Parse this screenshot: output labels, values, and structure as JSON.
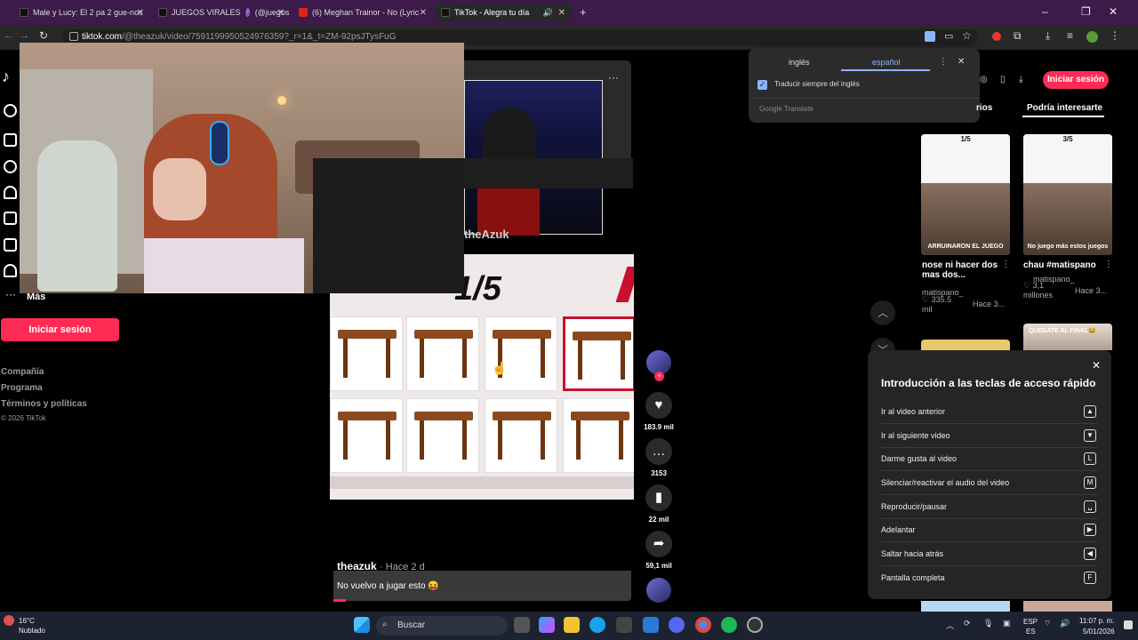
{
  "browser": {
    "tabs": [
      {
        "title": "Male y Lucy: El 2 pa 2 gue-nos"
      },
      {
        "title": "JUEGOS VIRALES 🪻 (@juegos"
      },
      {
        "title": "(6) Meghan Trainor - No (Lyric"
      },
      {
        "title": "TikTok - Alegra tu día"
      }
    ],
    "url_host": "tiktok.com",
    "url_path": "/@theazuk/video/7591199950524976359?_r=1&_t=ZM-92psJTysFuG"
  },
  "translate": {
    "tab_from": "inglés",
    "tab_to": "español",
    "checkbox_label": "Traducir siempre del inglés",
    "footer": "Google Translate"
  },
  "sidebar": {
    "more_label": "Más",
    "login_button": "Iniciar sesión",
    "links": [
      "Compañía",
      "Programa",
      "Términos y políticas"
    ],
    "copyright": "© 2026 TikTok"
  },
  "video": {
    "brand_overlay": "theAzuk",
    "puzzle_label": "1/5",
    "creator": "theazuk",
    "time_ago": "· Hace 2 d",
    "description": "No vuelvo a jugar esto 😝"
  },
  "actions": {
    "likes": "183.9 mil",
    "comments": "3153",
    "saves": "22 mil",
    "shares": "59,1 mil"
  },
  "right": {
    "login_button": "Iniciar sesión",
    "tab_partial": "rios",
    "tab_active": "Podría interesarte",
    "items": [
      {
        "frac": "1/5",
        "thumb_caption": "ARRUINARON EL JUEGO",
        "title": "nose ni hacer dos mas dos...",
        "user": "matispano_",
        "likes": "335.5 mil",
        "time": "Hace 3..."
      },
      {
        "frac": "3/5",
        "thumb_caption": "No juego más estos juegos",
        "title": "chau #matispano",
        "user": "matispano_",
        "likes": "3,1 millones",
        "time": "Hace 3..."
      }
    ],
    "peek_caption": "QUEDATE AL FINAL😂"
  },
  "shortcuts": {
    "title": "Introducción a las teclas de acceso rápido",
    "rows": [
      {
        "label": "Ir al video anterior",
        "key": "▲"
      },
      {
        "label": "Ir al siguiente video",
        "key": "▼"
      },
      {
        "label": "Darme gusta al video",
        "key": "L"
      },
      {
        "label": "Silenciar/reactivar el audio del video",
        "key": "M"
      },
      {
        "label": "Reproducir/pausar",
        "key": "␣"
      },
      {
        "label": "Adelantar",
        "key": "▶"
      },
      {
        "label": "Saltar hacia atrás",
        "key": "◀"
      },
      {
        "label": "Pantalla completa",
        "key": "F"
      }
    ]
  },
  "taskbar": {
    "temp": "16°C",
    "weather": "Nublado",
    "search_placeholder": "Buscar",
    "lang": "ESP",
    "lang_sub": "ES",
    "time": "11:07 p. m.",
    "date": "5/01/2026"
  },
  "colors": {
    "accent": "#fe2c55",
    "tab_bar": "#3c1a4a",
    "highlight_red": "#c8102e"
  }
}
